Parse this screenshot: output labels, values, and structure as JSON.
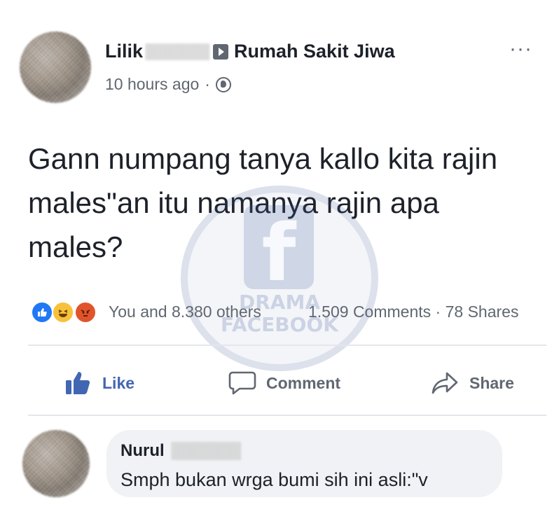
{
  "post": {
    "author_first_name": "Lilik",
    "group_name": "Rumah Sakit Jiwa",
    "timestamp": "10 hours ago",
    "separator": "·",
    "more_glyph": "···",
    "text": "Gann numpang tanya kallo kita rajin males\"an itu namanya rajin apa males?",
    "reactions_summary": "You and 8.380 others",
    "comments_count": "1.509 Comments",
    "shares_count": "78 Shares"
  },
  "actions": {
    "like_label": "Like",
    "comment_label": "Comment",
    "share_label": "Share"
  },
  "watermark": {
    "glyph": "f",
    "line1": "DRAMA",
    "line2": "FACEBOOK"
  },
  "comment": {
    "author_first_name": "Nurul",
    "text": "Smph bukan wrga bumi sih ini asli:\"v"
  },
  "colors": {
    "facebook_blue": "#4267b2",
    "like_reaction": "#2078f4",
    "haha_reaction": "#f7c13b",
    "angry_reaction": "#e0542c",
    "secondary_text": "#606770",
    "bubble_bg": "#f0f2f5"
  },
  "icons": {
    "audience": "globe-icon",
    "group_arrow": "triangle-right-icon",
    "like": "thumbs-up-icon",
    "comment": "speech-bubble-icon",
    "share": "share-arrow-icon"
  }
}
